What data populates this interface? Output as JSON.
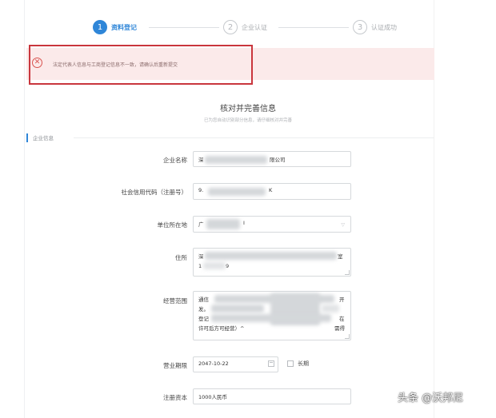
{
  "steps": [
    {
      "num": "1",
      "label": "资料登记",
      "state": "active"
    },
    {
      "num": "2",
      "label": "企业认证",
      "state": "todo"
    },
    {
      "num": "3",
      "label": "认证成功",
      "state": "todo"
    }
  ],
  "alert": {
    "icon": "error-circle-icon",
    "text": "法定代表人信息与工商登记信息不一致，请确认后重新提交",
    "color": "#d9534f"
  },
  "form": {
    "title": "核对并完善信息",
    "subtitle": "已为您自动识别部分信息，请仔细核对并完善",
    "section": "企业信息",
    "fields": {
      "company_name": {
        "label": "企业名称",
        "value_prefix": "深",
        "value_suffix": "限公司"
      },
      "credit_code": {
        "label": "社会信用代码（注册号）",
        "value_prefix": "9.",
        "value_suffix": "K"
      },
      "location": {
        "label": "单位所在地",
        "value_prefix": "广",
        "value_suffix": "I"
      },
      "address": {
        "label": "住所",
        "line1_prefix": "深",
        "line1_suffix": "室",
        "line2_prefix": "1",
        "line2_suffix": "9"
      },
      "business_scope": {
        "label": "经营范围",
        "line1_prefix": "通信",
        "line1_suffix": "开",
        "line2_prefix": "发。",
        "line3_prefix": "登记",
        "line3_suffix": "在",
        "line3_end": "需得",
        "line4": "许可后方可经营）^"
      },
      "business_term": {
        "label": "营业期限",
        "value": "2047-10-22",
        "checkbox_label": "长期"
      },
      "registered_capital": {
        "label": "注册资本",
        "value": "1000人民币"
      }
    }
  },
  "watermark": "头条 @沃邦尼",
  "accent_color": "#2f86d8"
}
